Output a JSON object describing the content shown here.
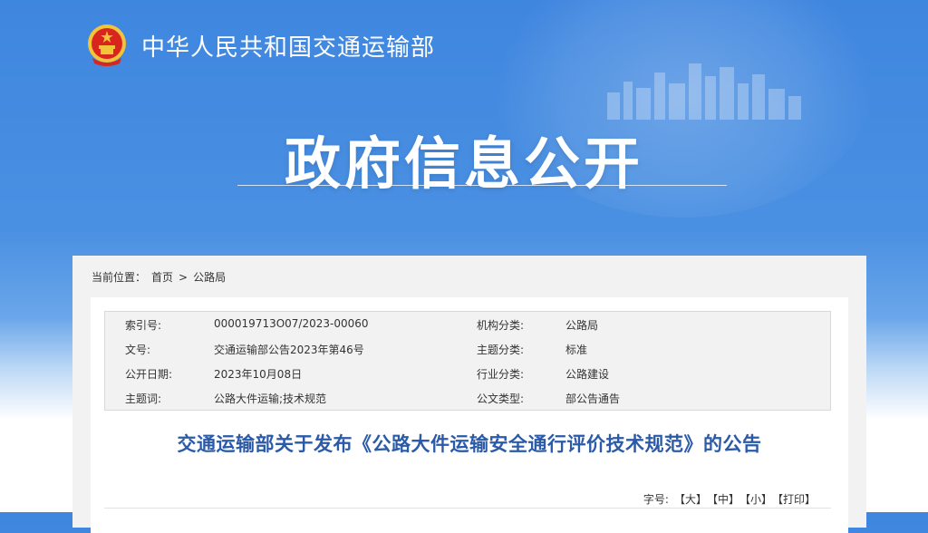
{
  "header": {
    "ministry_name": "中华人民共和国交通运输部",
    "banner_title": "政府信息公开"
  },
  "breadcrumb": {
    "label": "当前位置：",
    "home": "首页",
    "separator": ">",
    "current": "公路局"
  },
  "meta": {
    "rows": [
      {
        "label_left": "索引号:",
        "value_left": "000019713O07/2023-00060",
        "label_right": "机构分类:",
        "value_right": "公路局"
      },
      {
        "label_left": "文号:",
        "value_left": "交通运输部公告2023年第46号",
        "label_right": "主题分类:",
        "value_right": "标准"
      },
      {
        "label_left": "公开日期:",
        "value_left": "2023年10月08日",
        "label_right": "行业分类:",
        "value_right": "公路建设"
      },
      {
        "label_left": "主题词:",
        "value_left": "公路大件运输;技术规范",
        "label_right": "公文类型:",
        "value_right": "部公告通告"
      }
    ]
  },
  "article": {
    "title": "交通运输部关于发布《公路大件运输安全通行评价技术规范》的公告"
  },
  "font_size": {
    "label": "字号:",
    "large": "【大】",
    "medium": "【中】",
    "small": "【小】",
    "print": "【打印】"
  },
  "colors": {
    "banner_blue": "#4a90e2",
    "title_blue": "#2b5aa8",
    "emblem_red": "#d8261f",
    "emblem_gold": "#f3c33a"
  }
}
